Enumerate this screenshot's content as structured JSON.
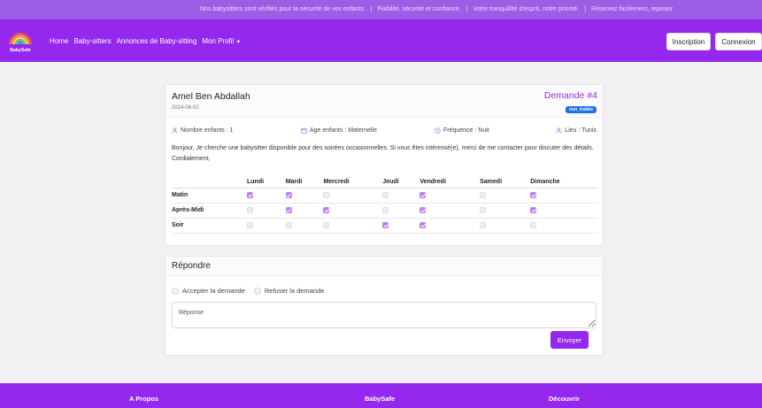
{
  "ticker": {
    "messages": [
      "Nos babysitters sont vérifiés pour la sécurité de vos enfants.",
      "Fiabilité, sécurité et confiance.",
      "Votre tranquillité d'esprit, notre priorité.",
      "Réservez facilement, reposez"
    ],
    "separator": "|"
  },
  "navbar": {
    "logo_text": "BabySafe",
    "links": [
      "Home",
      "Baby-sitters",
      "Annonces de Baby-sitting",
      "Mon Profil"
    ],
    "inscription_label": "Inscription",
    "connexion_label": "Connexion"
  },
  "request": {
    "name": "Amel Ben Abdallah",
    "date": "2024-06-02",
    "number": "Demande #4",
    "status": "non_traitée",
    "info": {
      "children": "Nombre enfants : 1",
      "age": "Age enfants : Maternelle",
      "frequency": "Fréquence : Nuit",
      "location": "Lieu : Tunis"
    },
    "description": "Bonjour, Je cherche une babysitter disponible pour des soirées occasionnelles. Si vous êtes intéressé(e), merci de me contacter pour discuter des détails. Cordialement,",
    "schedule": {
      "days": [
        "Lundi",
        "Mardi",
        "Mercredi",
        "Jeudi",
        "Vendredi",
        "Samedi",
        "Dimanche"
      ],
      "rows": [
        {
          "label": "Matin",
          "checked": [
            true,
            true,
            false,
            false,
            true,
            false,
            true
          ]
        },
        {
          "label": "Après-Midi",
          "checked": [
            false,
            true,
            true,
            false,
            true,
            false,
            true
          ]
        },
        {
          "label": "Soir",
          "checked": [
            false,
            false,
            false,
            true,
            true,
            false,
            false
          ]
        }
      ]
    }
  },
  "reply": {
    "title": "Répondre",
    "accept_label": "Accepter la demande",
    "refuse_label": "Refuser la demande",
    "response_placeholder": "Réponse",
    "send_label": "Envoyer"
  },
  "footer": {
    "col1": "A Propos",
    "col2": "BabySafe",
    "col3": "Découvrir"
  },
  "colors": {
    "primary": "#9428ee",
    "ticker_bg": "#9d5ee6",
    "status_badge": "#1f6fe8",
    "checkbox_on": "#c07ef0"
  }
}
